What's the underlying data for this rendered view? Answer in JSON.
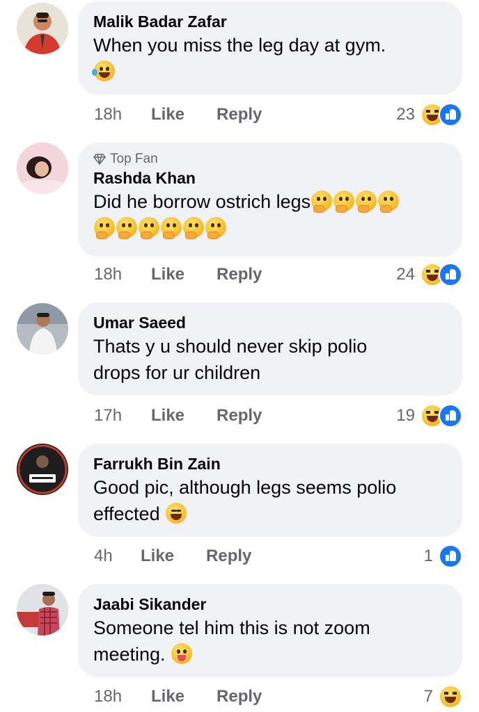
{
  "comments": [
    {
      "name": "Malik Badar Zafar",
      "text": "When you miss the leg day at gym.",
      "time": "18h",
      "like": "Like",
      "reply": "Reply",
      "reaction_count": "23",
      "avatar_color": "#c9453a"
    },
    {
      "badge": "Top Fan",
      "name": "Rashda Khan",
      "text": "Did he borrow ostrich legs",
      "time": "18h",
      "like": "Like",
      "reply": "Reply",
      "reaction_count": "24",
      "avatar_color": "#e8b7c0"
    },
    {
      "name": "Umar Saeed",
      "text_line1": "Thats y u should never skip polio",
      "text_line2": "drops for ur children",
      "time": "17h",
      "like": "Like",
      "reply": "Reply",
      "reaction_count": "19",
      "avatar_color": "#9aa7b3"
    },
    {
      "name": "Farrukh Bin Zain",
      "text_line1": "Good pic, although legs seems polio",
      "text_line2": "effected",
      "time": "4h",
      "like": "Like",
      "reply": "Reply",
      "reaction_count": "1",
      "avatar_color": "#222222"
    },
    {
      "name": "Jaabi Sikander",
      "text_line1": "Someone tel him this is not zoom",
      "text_line2": "meeting.",
      "time": "18h",
      "like": "Like",
      "reply": "Reply",
      "reaction_count": "7",
      "avatar_color": "#b8474a"
    }
  ]
}
